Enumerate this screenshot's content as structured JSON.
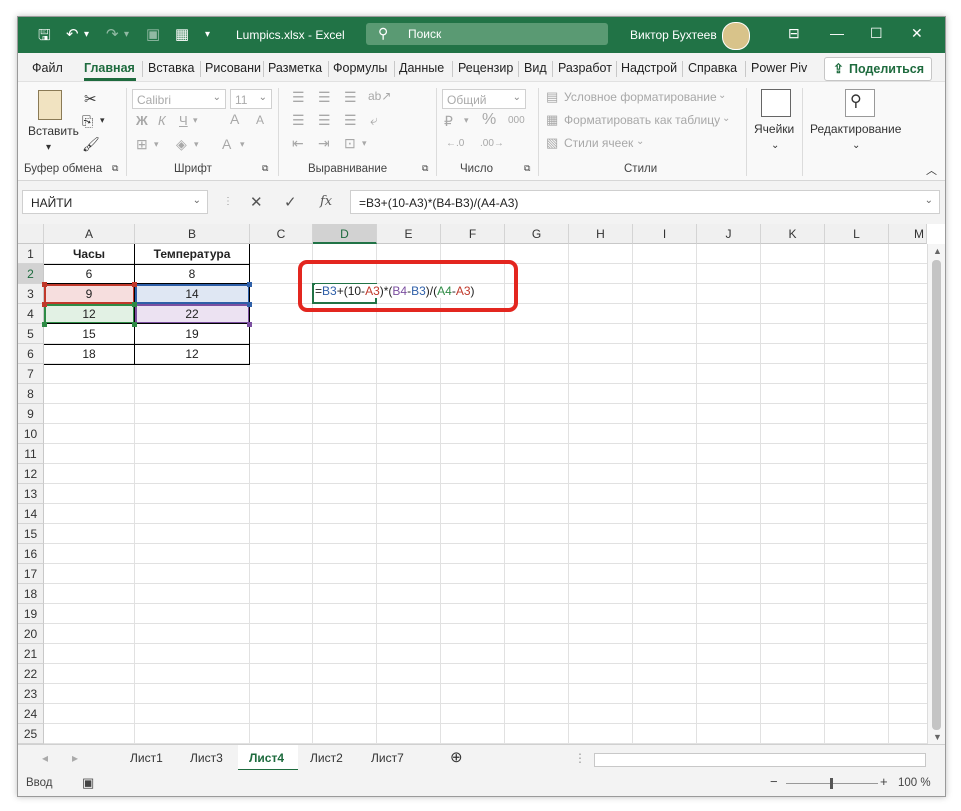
{
  "titlebar": {
    "filename": "Lumpics.xlsx",
    "separator": "-",
    "app": "Excel",
    "title": "Lumpics.xlsx  -  Excel",
    "search_placeholder": "Поиск",
    "user": "Виктор Бухтеев",
    "icons": [
      "save-icon",
      "undo-icon",
      "redo-icon",
      "camera-icon",
      "grid-icon",
      "dropdown-icon"
    ]
  },
  "tabs": [
    "Файл",
    "Главная",
    "Вставка",
    "Рисовани",
    "Разметка",
    "Формулы",
    "Данные",
    "Рецензир",
    "Вид",
    "Разработ",
    "Надстрой",
    "Справка",
    "Power Piv"
  ],
  "share_label": "Поделиться",
  "ribbon": {
    "clipboard": {
      "paste": "Вставить",
      "group": "Буфер обмена"
    },
    "font": {
      "name": "Calibri",
      "size": "11",
      "bold": "Ж",
      "italic": "К",
      "underline": "Ч",
      "grow": "A",
      "shrink": "A",
      "color_a": "A",
      "group": "Шрифт"
    },
    "alignment": {
      "group": "Выравнивание"
    },
    "number": {
      "format": "Общий",
      "percent": "%",
      "thousands": "000",
      "group": "Число"
    },
    "styles": {
      "conditional": "Условное форматирование",
      "as_table": "Форматировать как таблицу",
      "cell_styles": "Стили ячеек",
      "group": "Стили"
    },
    "cells": {
      "label": "Ячейки"
    },
    "editing": {
      "label": "Редактирование"
    }
  },
  "formula_bar": {
    "name_box": "НАЙТИ",
    "cancel": "✕",
    "enter": "✓",
    "fx": "fx",
    "formula": "=B3+(10-A3)*(B4-B3)/(A4-A3)"
  },
  "columns": [
    "A",
    "B",
    "C",
    "D",
    "E",
    "F",
    "G",
    "H",
    "I",
    "J",
    "K",
    "L",
    "M"
  ],
  "rows": [
    "1",
    "2",
    "3",
    "4",
    "5",
    "6",
    "7",
    "8",
    "9",
    "10",
    "11",
    "12",
    "13",
    "14",
    "15",
    "16",
    "17",
    "18",
    "19",
    "20",
    "21",
    "22",
    "23",
    "24",
    "25"
  ],
  "table": {
    "headers": [
      "Часы",
      "Температура"
    ],
    "rows": [
      [
        "6",
        "8"
      ],
      [
        "9",
        "14"
      ],
      [
        "12",
        "22"
      ],
      [
        "15",
        "19"
      ],
      [
        "18",
        "12"
      ]
    ]
  },
  "edit_formula_parts": [
    {
      "t": "=",
      "c": "#222"
    },
    {
      "t": "B3",
      "c": "#2e5fa8"
    },
    {
      "t": "+(10-",
      "c": "#222"
    },
    {
      "t": "A3",
      "c": "#c0392b"
    },
    {
      "t": ")*(",
      "c": "#222"
    },
    {
      "t": "B4",
      "c": "#7b4fa0"
    },
    {
      "t": "-",
      "c": "#222"
    },
    {
      "t": "B3",
      "c": "#2e5fa8"
    },
    {
      "t": ")/(",
      "c": "#222"
    },
    {
      "t": "A4",
      "c": "#2e8b45"
    },
    {
      "t": "-",
      "c": "#222"
    },
    {
      "t": "A3",
      "c": "#c0392b"
    },
    {
      "t": ")",
      "c": "#222"
    }
  ],
  "sheets": [
    "Лист1",
    "Лист3",
    "Лист4",
    "Лист2",
    "Лист7"
  ],
  "active_sheet": "Лист4",
  "status": {
    "mode": "Ввод",
    "zoom": "100 %"
  },
  "colors": {
    "accent": "#217346",
    "highlight": "#e3261f"
  }
}
